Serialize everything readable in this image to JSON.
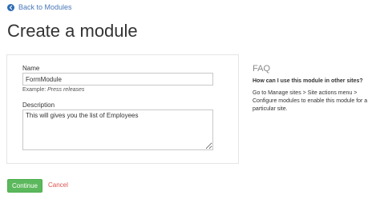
{
  "nav": {
    "back_label": "Back to Modules",
    "back_icon": "arrow-left-circle-icon"
  },
  "page": {
    "title": "Create a module"
  },
  "form": {
    "name_label": "Name",
    "name_value": "FormModule",
    "example_prefix": "Example:",
    "example_value": "Press releases",
    "description_label": "Description",
    "description_value": "This will gives you the list of Employees"
  },
  "faq": {
    "heading": "FAQ",
    "question": "How can I use this module in other sites?",
    "answer": "Go to Manage sites > Site actions menu > Configure modules to enable this module for a particular site."
  },
  "actions": {
    "continue_label": "Continue",
    "cancel_label": "Cancel"
  },
  "colors": {
    "accent_blue": "#2f6db5",
    "continue_green": "#5cb85c",
    "cancel_red": "#d9534f"
  }
}
